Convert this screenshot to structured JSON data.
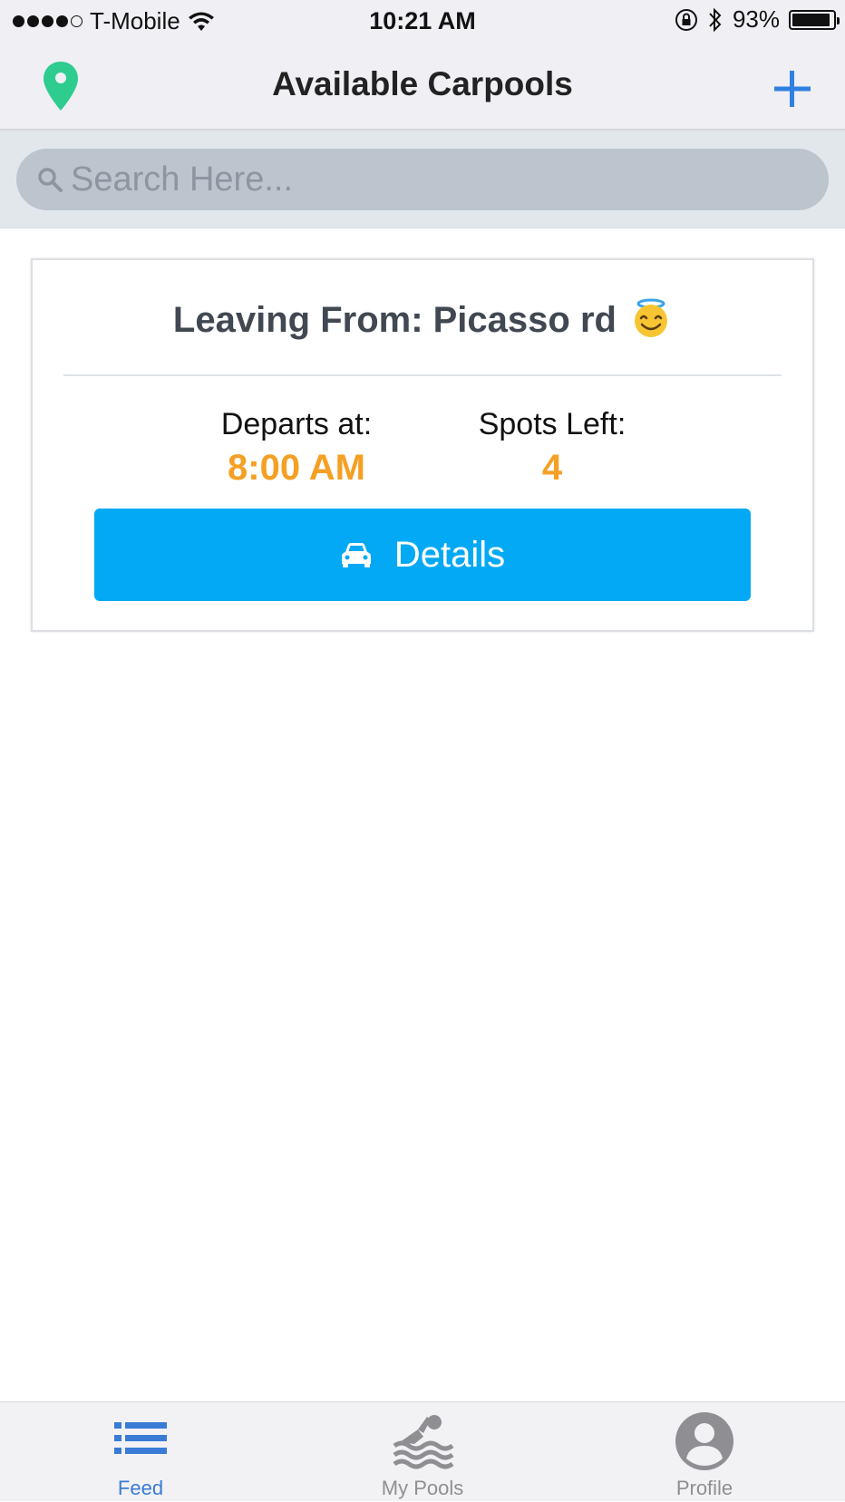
{
  "status_bar": {
    "carrier": "T-Mobile",
    "time": "10:21 AM",
    "battery": "93%",
    "battery_level": 0.93,
    "signal_bars": 4
  },
  "nav": {
    "title": "Available Carpools",
    "left_icon": "map-pin-icon",
    "right_icon": "plus-icon"
  },
  "search": {
    "placeholder": "Search Here..."
  },
  "carpools": [
    {
      "leaving_from": "Leaving From: Picasso rd",
      "emoji": "smiling-face-with-halo",
      "departs_label": "Departs at:",
      "departs_value": "8:00 AM",
      "spots_label": "Spots Left:",
      "spots_value": "4",
      "details_label": "Details"
    }
  ],
  "tabs": [
    {
      "label": "Feed",
      "icon": "list-icon",
      "active": true
    },
    {
      "label": "My Pools",
      "icon": "swimmer-icon",
      "active": false
    },
    {
      "label": "Profile",
      "icon": "user-icon",
      "active": false
    }
  ],
  "colors": {
    "accent": "#03a9f4",
    "highlight": "#f5a024",
    "pin": "#2ecc8f",
    "tab_active": "#3a7bd5",
    "plus": "#2f80e0"
  }
}
